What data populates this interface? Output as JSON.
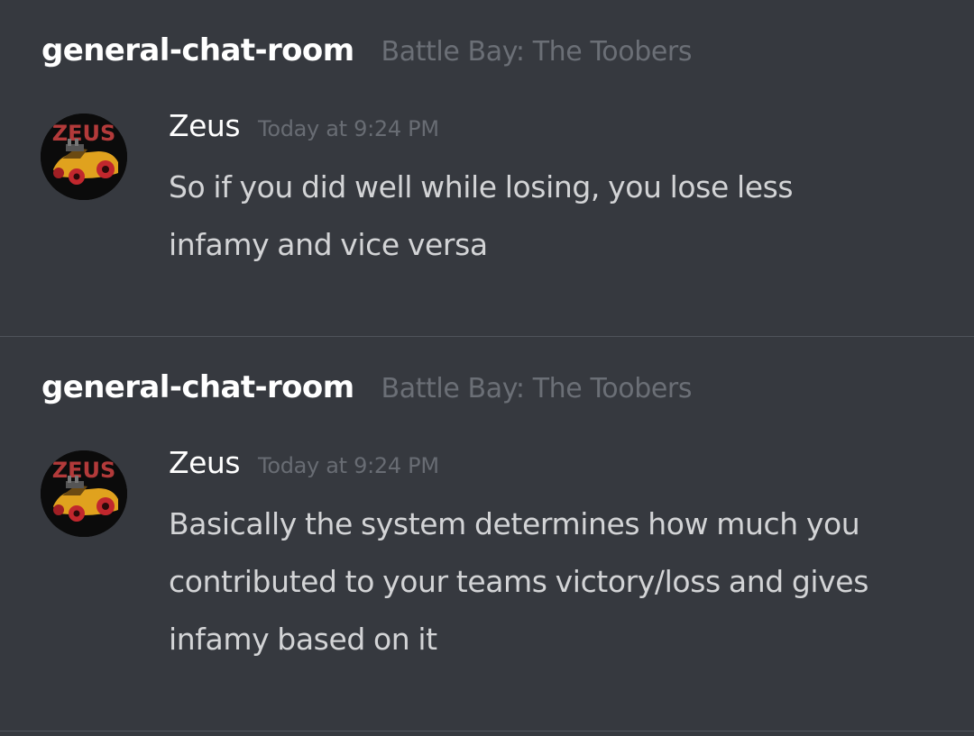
{
  "messages": [
    {
      "channel": "general-chat-room",
      "server": "Battle Bay: The Toobers",
      "author": "Zeus",
      "timestamp": "Today at 9:24 PM",
      "avatar_text": "ZEUS",
      "lines": [
        "So if you did well while losing, you lose less",
        "infamy and vice versa"
      ]
    },
    {
      "channel": "general-chat-room",
      "server": "Battle Bay: The Toobers",
      "author": "Zeus",
      "timestamp": "Today at 9:24 PM",
      "avatar_text": "ZEUS",
      "lines": [
        "Basically the system determines how much you",
        "contributed to your teams victory/loss and gives",
        "infamy based on it"
      ]
    }
  ],
  "colors": {
    "background": "#36393f",
    "channel": "#ffffff",
    "server": "#6b6f76",
    "author": "#ffffff",
    "timestamp": "#686c73",
    "message": "#d3d4d6",
    "divider": "#4f535b"
  }
}
